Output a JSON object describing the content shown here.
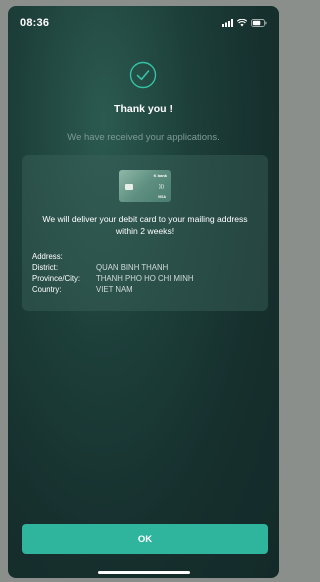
{
  "status_bar": {
    "time": "08:36"
  },
  "confirmation": {
    "title": "Thank you !",
    "subtitle": "We have received your applications."
  },
  "card_info": {
    "card_bank": "K bank",
    "card_network": "VISA",
    "delivery_message": "We will deliver your debit card to your mailing address within 2 weeks!"
  },
  "address": {
    "rows": [
      {
        "label": "Address:",
        "value": ""
      },
      {
        "label": "District:",
        "value": "QUAN BINH THANH"
      },
      {
        "label": "Province/City:",
        "value": "THANH PHO HO CHI MINH"
      },
      {
        "label": "Country:",
        "value": "VIET NAM"
      }
    ]
  },
  "actions": {
    "ok_label": "OK"
  },
  "colors": {
    "accent": "#2fb59d",
    "background": "#1d3f3a"
  }
}
